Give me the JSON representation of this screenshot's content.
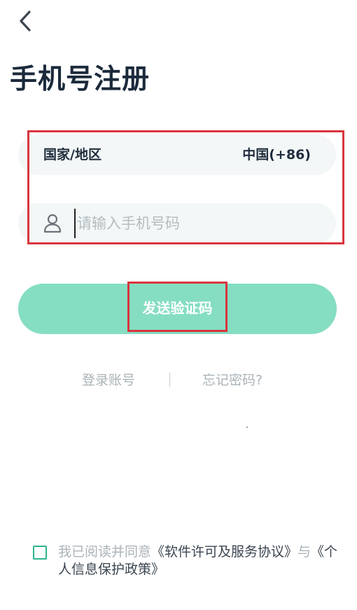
{
  "header": {
    "back_icon": "chevron-left-icon",
    "title": "手机号注册"
  },
  "form": {
    "region_label": "国家/地区",
    "region_value": "中国(+86)",
    "phone_placeholder": "请输入手机号码",
    "phone_value": "",
    "user_icon": "user-icon",
    "send_code_label": "发送验证码"
  },
  "links": {
    "login": "登录账号",
    "forgot": "忘记密码?"
  },
  "agreement": {
    "checked": false,
    "prefix": "我已阅读并同意",
    "license": "《软件许可及服务协议》",
    "and": "与",
    "privacy": "《个人信息保护政策》"
  },
  "colors": {
    "accent": "#85ddc2",
    "checkbox": "#2fb391",
    "highlight": "#d9363e",
    "title": "#1b2a3b",
    "field_bg": "#f3f7f7"
  }
}
